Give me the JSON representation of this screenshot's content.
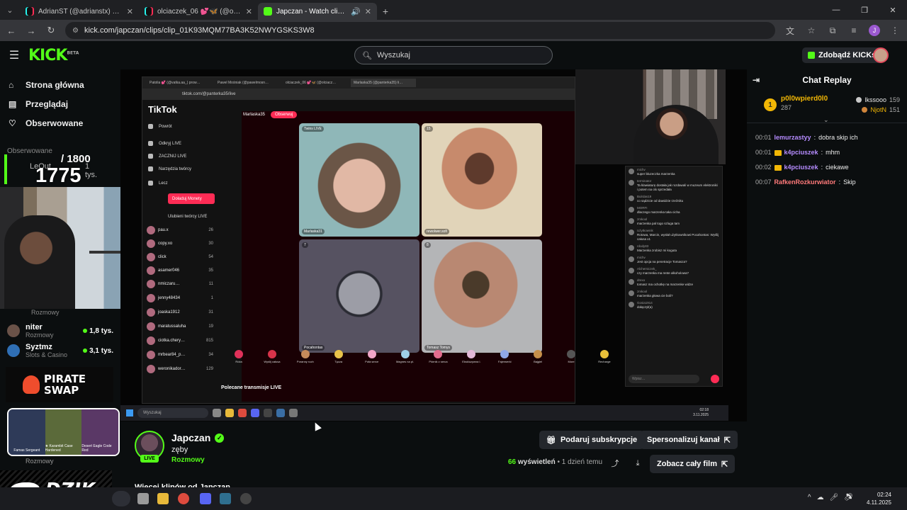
{
  "browser": {
    "tabs": [
      {
        "title": "AdrianST (@adrianstx) prowadz…",
        "active": false,
        "favicon": "tiktok-icon"
      },
      {
        "title": "olciaczek_06 💕🦋 (@olciacze…",
        "active": false,
        "favicon": "tiktok-icon"
      },
      {
        "title": "Japczan - Watch clips on Ki…",
        "active": true,
        "favicon": "kick-icon"
      }
    ],
    "url": "kick.com/japczan/clips/clip_01K93MQM77BA3K52NWYGSKS3W8",
    "profile_initial": "J"
  },
  "header": {
    "logo": "KICK",
    "logo_tag": "BETA",
    "search_placeholder": "Wyszukaj",
    "get_kicks_label": "Zdobądź KICKs"
  },
  "sidebar": {
    "nav": [
      {
        "label": "Strona główna",
        "icon": "home-icon"
      },
      {
        "label": "Przeglądaj",
        "icon": "browse-icon"
      },
      {
        "label": "Obserwowane",
        "icon": "heart-icon"
      }
    ],
    "followed_heading": "Obserwowane",
    "overlay_counter": {
      "current": "1775",
      "goal": "/ 1800",
      "ghost_name": "LeOut",
      "ghost_views": "1 tys."
    },
    "items": [
      {
        "name": "",
        "category": "Rozmowy",
        "viewers": ""
      },
      {
        "name": "niter",
        "category": "Rozmowy",
        "viewers": "1,8 tys."
      },
      {
        "name": "Syztmz",
        "category": "Slots & Casino",
        "viewers": "3,1 tys."
      }
    ],
    "sponsor_pirate": [
      "PIRATE",
      "SWAP"
    ],
    "knives_labels": [
      "Famas Sergeant",
      "★ Karambit Case Hardened",
      "Desert Eagle Code Red"
    ],
    "last_category": "Rozmowy",
    "sponsor_dzik": "DZIK"
  },
  "inner": {
    "tabs": [
      "Patolia 💕 (@vatka.aa_) prow…",
      "Pawel Mośniak (@pawelmosn…",
      "olciaczek_06 💕🦋 (@olciacz…",
      "Marlaska35 (@panterka35) li…"
    ],
    "url": "tiktok.com/@panterka35/live",
    "tiktok_logo": "TikTok",
    "nav": [
      "Powrót",
      "Odkryj LIVE",
      "ZACZNIJ LIVE",
      "Narzędzia twórcy",
      "Lecz"
    ],
    "get_coins": "Doładuj Monety",
    "followed_label": "Ulubieni twórcy LIVE",
    "users": [
      {
        "name": "pau.x",
        "n": "26"
      },
      {
        "name": "copy.xo",
        "n": "30"
      },
      {
        "name": "click",
        "n": "54"
      },
      {
        "name": "asamer046",
        "n": "35"
      },
      {
        "name": "nmiczaru…",
        "n": "11"
      },
      {
        "name": "jenny48434",
        "n": "1"
      },
      {
        "name": "joaska1912",
        "n": "31"
      },
      {
        "name": "maratussaluha",
        "n": "19"
      },
      {
        "name": "ciotka.chery…",
        "n": "815"
      },
      {
        "name": "mrbear84_p…",
        "n": "34"
      },
      {
        "name": "weronikador…",
        "n": "129"
      }
    ],
    "host": "Marlaska35",
    "follow_label": "Obserwuj",
    "tiles": [
      {
        "name": "Marlaska31",
        "tag": "Twins LIVE"
      },
      {
        "name": "rewolwer.sofi",
        "tag": "15"
      },
      {
        "name": "Pocahontas",
        "tag": "7"
      },
      {
        "name": "Tomasz Tomys",
        "tag": "8"
      }
    ],
    "gifts": [
      "Róża",
      "Wyślij całusa",
      "Poranny ruch",
      "Tęcza",
      "Pufa serce",
      "Magnes na pl.",
      "Piórnik z serca",
      "Ekskluzywna l.",
      "Fajerwerki",
      "Bajgiel",
      "More",
      "Recharge"
    ],
    "recommended": "Polecane transmisje LIVE",
    "chat": [
      {
        "user": "michv",
        "text": "super bluzeczka marzenka"
      },
      {
        "user": "terminator",
        "text": "Ta klawiaturę dostała jak rozdawali w muzeum elektroniki i potem na olx sprzedała"
      },
      {
        "user": "Bulrdas19",
        "text": "co sądzicie od dawidzie rzeźniku"
      },
      {
        "user": "MORFI",
        "text": "dlaczego marzenka taka cicha"
      },
      {
        "user": "zmkool",
        "text": "marzenka pal togo szluga tam"
      },
      {
        "user": "Użytkownik",
        "text": "Rotowa, Marcin, wysłał użytkownikowi Pocahontas: Wyślij całusa x1"
      },
      {
        "user": "rdody83",
        "text": "Marzenka zrobisz mi koguta"
      },
      {
        "user": "michv",
        "text": "Jest opcja na penetracje Tomasza?"
      },
      {
        "user": "Alchemiczek_",
        "text": "czy marzenka ma rente alkoholowa?"
      },
      {
        "user": "drexo",
        "text": "tomasz ma ochotkę na marzenke widze"
      },
      {
        "user": "zmkool",
        "text": "marzenka głowa cie boli?"
      },
      {
        "user": "Gosia1914",
        "text": "dołączył(a)"
      }
    ],
    "chat_input": "Wpisz…",
    "taskbar_search": "Wyszukaj",
    "clock": [
      "02:18",
      "3.11.2025"
    ]
  },
  "chat": {
    "title": "Chat Replay",
    "leader": {
      "rank": "1",
      "name": "p0l0wpierd0l0",
      "value": "287"
    },
    "others": [
      {
        "name": "lkssooo",
        "value": "159"
      },
      {
        "name": "NjotN",
        "value": "151"
      }
    ],
    "messages": [
      {
        "time": "00:01",
        "user": "lemurzastyy",
        "color": "#b68cff",
        "badge": false,
        "text": "dobra skip ich"
      },
      {
        "time": "00:01",
        "user": "k4pciuszek",
        "color": "#b68cff",
        "badge": true,
        "text": "mhm"
      },
      {
        "time": "00:02",
        "user": "k4pciuszek",
        "color": "#b68cff",
        "badge": true,
        "text": "ciekawe"
      },
      {
        "time": "00:07",
        "user": "RafkenRozkurwiator",
        "color": "#ff7a7a",
        "badge": false,
        "text": "Skip"
      }
    ]
  },
  "channel": {
    "name": "Japczan",
    "live_label": "LIVE",
    "clip_title": "zęby",
    "category": "Rozmowy",
    "subscribe_label": "Podaruj subskrypcje",
    "customize_label": "Spersonalizuj kanał",
    "views_count": "66",
    "views_label": "wyświetleń",
    "age_label": "• 1 dzień temu",
    "full_movie_label": "Zobacz cały film",
    "more_from": "Więcej klipów od Japczan"
  },
  "taskbar": {
    "clock": [
      "02:24",
      "4.11.2025"
    ]
  },
  "colors": {
    "kick_green": "#53fc18",
    "tiktok_red": "#fe2c55"
  }
}
